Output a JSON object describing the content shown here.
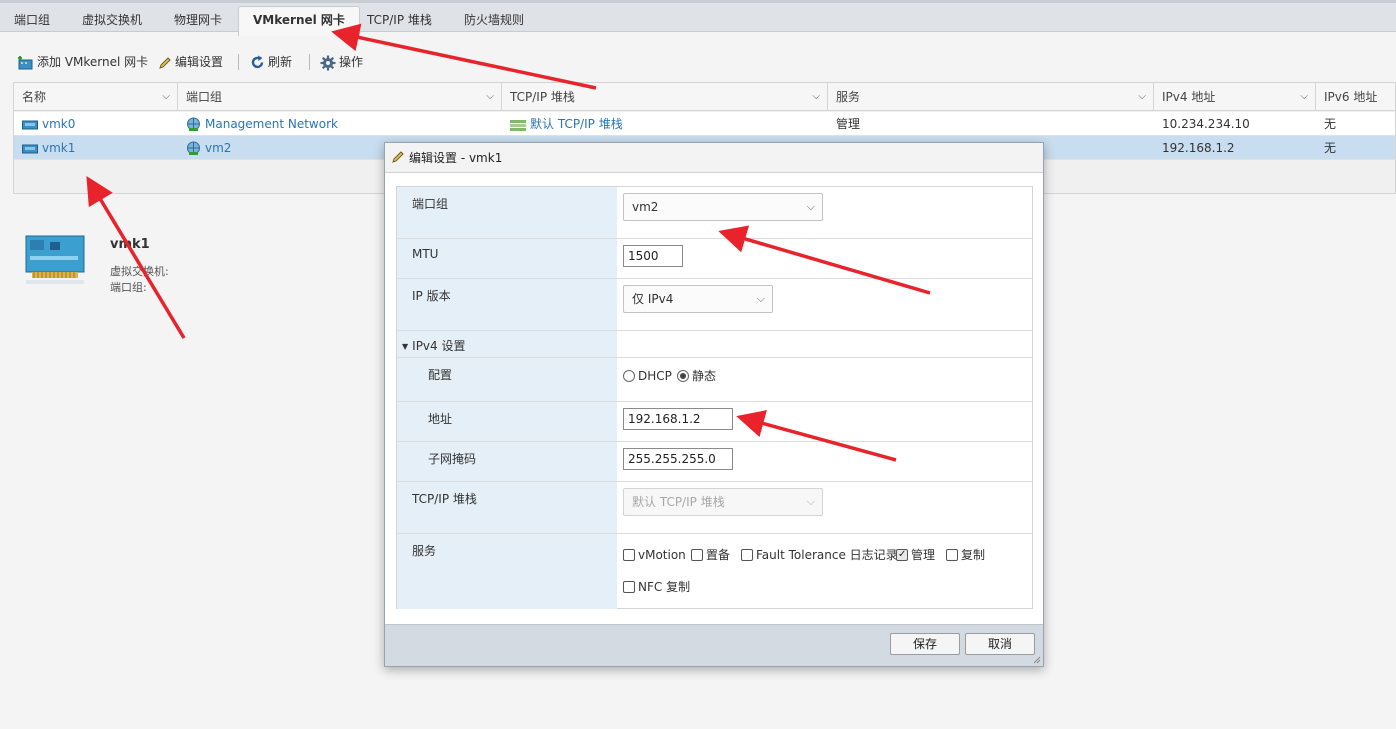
{
  "tabs": [
    {
      "label": "端口组"
    },
    {
      "label": "虚拟交换机"
    },
    {
      "label": "物理网卡"
    },
    {
      "label": "VMkernel 网卡"
    },
    {
      "label": "TCP/IP 堆栈"
    },
    {
      "label": "防火墙规则"
    }
  ],
  "toolbar": {
    "add": "添加 VMkernel 网卡",
    "edit": "编辑设置",
    "refresh": "刷新",
    "actions": "操作"
  },
  "grid": {
    "headers": [
      "名称",
      "端口组",
      "TCP/IP 堆栈",
      "服务",
      "IPv4 地址",
      "IPv6 地址"
    ],
    "rows": [
      {
        "name": "vmk0",
        "portgroup": "Management Network",
        "stack": "默认 TCP/IP 堆栈",
        "services": "管理",
        "ipv4": "10.234.234.10",
        "ipv6": "无"
      },
      {
        "name": "vmk1",
        "portgroup": "vm2",
        "stack": "",
        "services": "",
        "ipv4": "192.168.1.2",
        "ipv6": "无"
      }
    ]
  },
  "detail": {
    "title": "vmk1",
    "vswitch_label": "虚拟交换机:",
    "portgroup_label": "端口组:"
  },
  "dialog": {
    "title": "编辑设置 - vmk1",
    "portgroup": {
      "label": "端口组",
      "value": "vm2"
    },
    "mtu": {
      "label": "MTU",
      "value": "1500"
    },
    "ipversion": {
      "label": "IP 版本",
      "value": "仅 IPv4"
    },
    "ipv4_section": "IPv4 设置",
    "config": {
      "label": "配置",
      "dhcp": "DHCP",
      "static": "静态"
    },
    "address": {
      "label": "地址",
      "value": "192.168.1.2"
    },
    "netmask": {
      "label": "子网掩码",
      "value": "255.255.255.0"
    },
    "tcpip": {
      "label": "TCP/IP 堆栈",
      "value": "默认 TCP/IP 堆栈"
    },
    "services": {
      "label": "服务",
      "items": [
        {
          "label": "vMotion",
          "checked": false
        },
        {
          "label": "置备",
          "checked": false
        },
        {
          "label": "Fault Tolerance 日志记录",
          "checked": false
        },
        {
          "label": "管理",
          "checked": true
        },
        {
          "label": "复制",
          "checked": false
        },
        {
          "label": "NFC 复制",
          "checked": false
        }
      ]
    },
    "save": "保存",
    "cancel": "取消"
  },
  "colors": {
    "annotation_arrow": "#e8232b",
    "selected_row": "#c8ddef",
    "link": "#2a76b5"
  }
}
